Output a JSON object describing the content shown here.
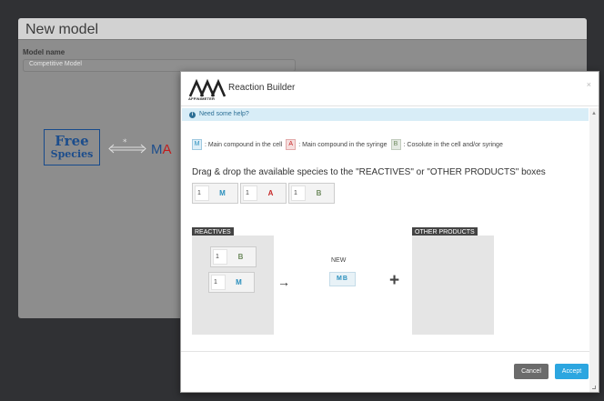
{
  "background": {
    "title": "New model",
    "model_name_label": "Model name",
    "model_name_value": "Competitive Model",
    "free_species": {
      "line1": "Free",
      "line2": "Species"
    },
    "arrow_label": "*",
    "product": {
      "m": "M",
      "a": "A"
    }
  },
  "modal": {
    "brand": "AFFINIMETER",
    "title": "Reaction Builder",
    "close": "×",
    "help": "Need some help?",
    "legend": [
      {
        "letter": "M",
        "text": ": Main compound in the cell"
      },
      {
        "letter": "A",
        "text": ": Main compound in the syringe"
      },
      {
        "letter": "B",
        "text": ": Cosolute in the cell and/or syringe"
      }
    ],
    "instructions": "Drag & drop the available species to the \"REACTIVES\" or \"OTHER PRODUCTS\" boxes",
    "available_species": [
      {
        "count": "1",
        "letter": "M"
      },
      {
        "count": "1",
        "letter": "A"
      },
      {
        "count": "1",
        "letter": "B"
      }
    ],
    "reactives_label": "REACTIVES",
    "reactives": [
      {
        "count": "1",
        "letter": "B"
      },
      {
        "count": "1",
        "letter": "M"
      }
    ],
    "arrow": "→",
    "new_label": "NEW",
    "new_product": "MB",
    "plus": "+",
    "other_products_label": "OTHER PRODUCTS",
    "cancel": "Cancel",
    "accept": "Accept"
  },
  "colors": {
    "m": "#2a8fbd",
    "a": "#c62727",
    "b": "#6e8a5e",
    "accept": "#2ca6e0",
    "cancel": "#6b6b6b"
  }
}
